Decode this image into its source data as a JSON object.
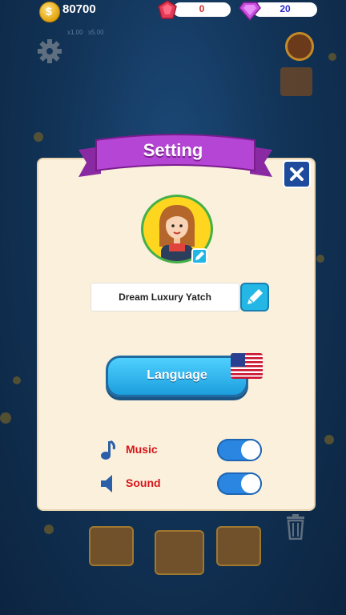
{
  "top_bar": {
    "coins": "80700",
    "rubies": "0",
    "diamonds": "20",
    "multiplier_1": "x1.00",
    "multiplier_2": "x5.00"
  },
  "dialog": {
    "title": "Setting",
    "player_name": "Dream Luxury Yatch",
    "language_button": "Language",
    "language_flag": "us-flag",
    "music_label": "Music",
    "music_on": true,
    "sound_label": "Sound",
    "sound_on": true
  },
  "colors": {
    "ribbon": "#b545d4",
    "panel": "#fbf0dc",
    "close_button": "#1f4b9c",
    "language_button": "#2bb0ef",
    "toggle_on": "#2a86e0",
    "label_red": "#d6151a"
  },
  "icons": [
    "coin-icon",
    "ruby-icon",
    "diamond-icon",
    "gear-icon",
    "close-icon",
    "edit-icon",
    "music-icon",
    "speaker-icon",
    "trash-icon",
    "shop-icon"
  ]
}
